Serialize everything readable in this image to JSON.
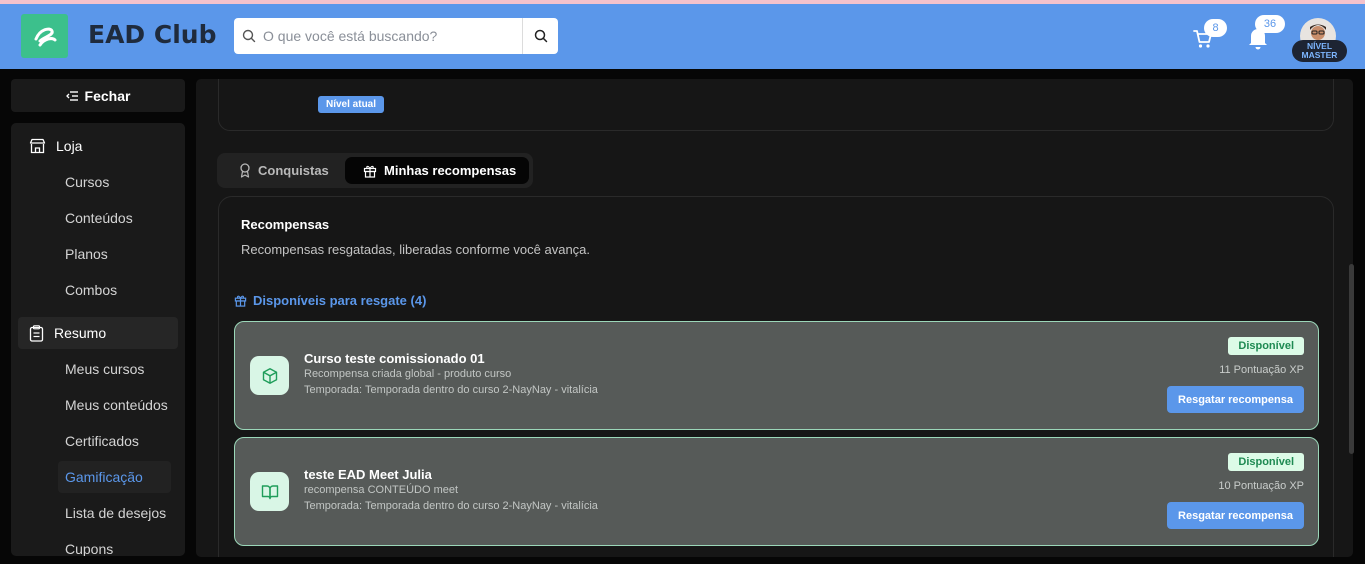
{
  "header": {
    "app_title": "EAD Club",
    "search_placeholder": "O que você está buscando?",
    "cart_count": "8",
    "notifications_count": "36",
    "level_line1": "NÍVEL",
    "level_line2": "MASTER",
    "brand_color": "#5b97ea",
    "logo_color": "#3cc08c"
  },
  "sidebar": {
    "close_label": "Fechar",
    "store": {
      "label": "Loja",
      "items": [
        "Cursos",
        "Conteúdos",
        "Planos",
        "Combos"
      ]
    },
    "summary": {
      "label": "Resumo",
      "items": [
        "Meus cursos",
        "Meus conteúdos",
        "Certificados",
        "Gamificação",
        "Lista de desejos",
        "Cupons"
      ],
      "active": "Gamificação"
    }
  },
  "main": {
    "level_chip": "Nível atual",
    "tabs": [
      {
        "label": "Conquistas",
        "icon": "award-icon",
        "active": false
      },
      {
        "label": "Minhas recompensas",
        "icon": "gift-icon",
        "active": true
      }
    ],
    "rewards": {
      "title": "Recompensas",
      "subtitle": "Recompensas resgatadas, liberadas conforme você avança.",
      "available_label": "Disponíveis para resgate (4)",
      "items": [
        {
          "title": "Curso teste comissionado 01",
          "description": "Recompensa criada global - produto curso",
          "season": "Temporada: Temporada dentro do curso 2-NayNay - vitalícia",
          "status": "Disponível",
          "points": "11 Pontuação XP",
          "button": "Resgatar recompensa",
          "icon": "box-icon"
        },
        {
          "title": "teste EAD Meet Julia",
          "description": "recompensa CONTEÚDO meet",
          "season": "Temporada: Temporada dentro do curso 2-NayNay - vitalícia",
          "status": "Disponível",
          "points": "10 Pontuação XP",
          "button": "Resgatar recompensa",
          "icon": "book-icon"
        }
      ]
    }
  }
}
